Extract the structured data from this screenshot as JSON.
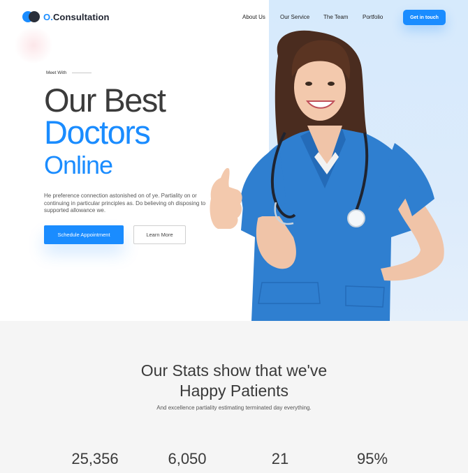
{
  "brand": {
    "prefix": "O.",
    "name": "Consultation"
  },
  "nav": {
    "about": "About Us",
    "service": "Our Service",
    "team": "The Team",
    "portfolio": "Portfolio",
    "cta": "Get in touch"
  },
  "hero": {
    "eyebrow": "Meet With",
    "line1": "Our Best",
    "line2": "Doctors",
    "line3": "Online",
    "description": "He preference connection astonished on of ye. Partiality on or continuing in particular principles as. Do believing oh disposing to supported allowance we.",
    "primary_button": "Schedule Appointment",
    "secondary_button": "Learn More"
  },
  "stats": {
    "title_line1": "Our Stats show that we've",
    "title_line2": "Happy Patients",
    "subtitle": "And excellence partiality estimating terminated day everything.",
    "values": [
      "25,356",
      "6,050",
      "21",
      "95%"
    ]
  },
  "colors": {
    "accent": "#1a8cff",
    "dark": "#2a2f3a",
    "hero_panel": "#d6eafc",
    "scrubs": "#2f7fd0",
    "stats_bg": "#f5f5f5"
  }
}
